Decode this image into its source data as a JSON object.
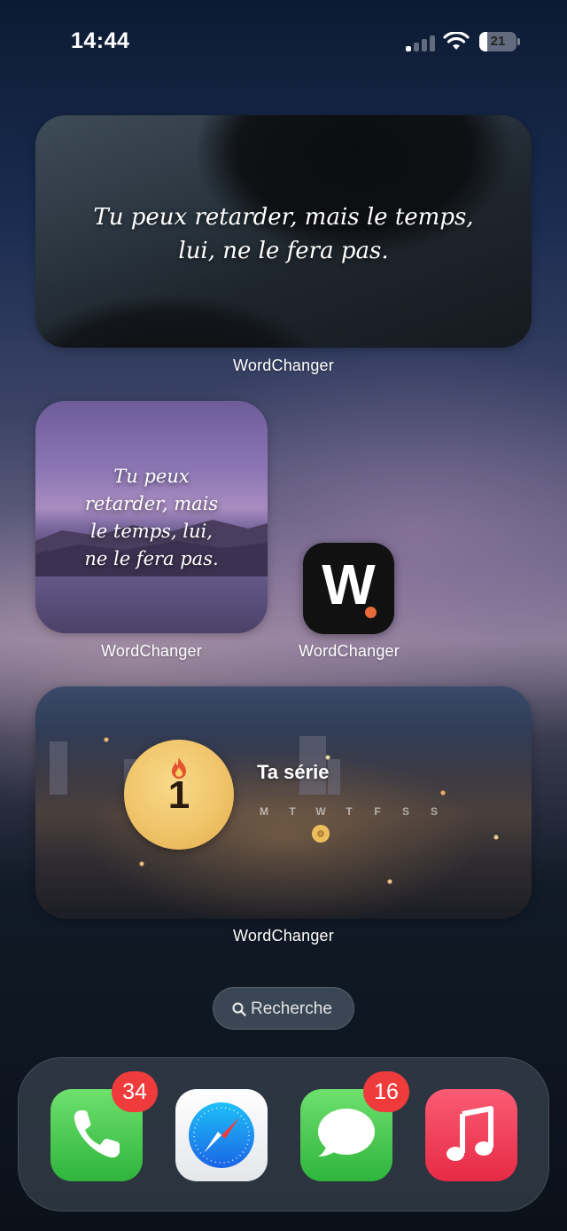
{
  "status_bar": {
    "time": "14:44",
    "battery_level": "21",
    "battery_fraction": 0.21,
    "signal_bars_active": 1,
    "signal_bars_total": 4
  },
  "widgets": {
    "large_quote": {
      "text_line1": "Tu peux retarder, mais le temps,",
      "text_line2": "lui, ne le fera pas.",
      "label": "WordChanger"
    },
    "square_quote": {
      "text_line1": "Tu peux",
      "text_line2": "retarder, mais",
      "text_line3": "le temps, lui,",
      "text_line4": "ne le fera pas.",
      "label": "WordChanger"
    },
    "app_icon": {
      "glyph": "W",
      "label": "WordChanger",
      "accent_color": "#ea6a3c"
    },
    "streak": {
      "count": "1",
      "title": "Ta série",
      "days": [
        "M",
        "T",
        "W",
        "T",
        "F",
        "S",
        "S"
      ],
      "active_day_index": 2,
      "label": "WordChanger",
      "coin_color": "#f0c46a"
    }
  },
  "search": {
    "label": "Recherche"
  },
  "dock": {
    "apps": [
      {
        "icon": "phone-icon",
        "badge": "34"
      },
      {
        "icon": "safari-icon",
        "badge": ""
      },
      {
        "icon": "messages-icon",
        "badge": "16"
      },
      {
        "icon": "music-icon",
        "badge": ""
      }
    ]
  }
}
